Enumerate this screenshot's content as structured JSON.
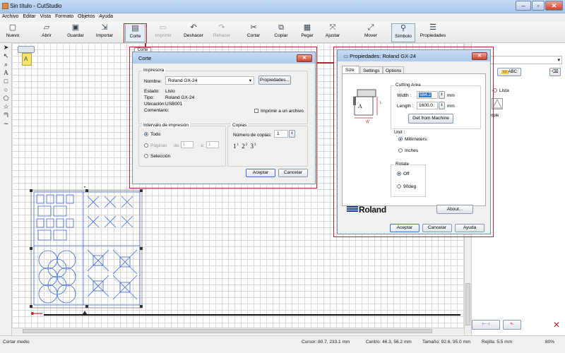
{
  "window": {
    "title": "Sin título - CutStudio"
  },
  "menu": [
    "Archivo",
    "Editar",
    "Vista",
    "Formato",
    "Objetos",
    "Ayuda"
  ],
  "toolbar": [
    {
      "label": "Nuevo",
      "icon": "new-file-icon",
      "glyph": "▢"
    },
    {
      "label": "Abrir",
      "icon": "folder-open-icon",
      "glyph": "▱"
    },
    {
      "label": "Guardar",
      "icon": "save-icon",
      "glyph": "▣"
    },
    {
      "label": "Importar",
      "icon": "import-icon",
      "glyph": "⇲"
    },
    {
      "label": "Corte",
      "icon": "cut-plotter-icon",
      "glyph": "▤"
    },
    {
      "label": "Imprimir",
      "icon": "print-icon",
      "glyph": "▭"
    },
    {
      "label": "Deshacer",
      "icon": "undo-icon",
      "glyph": "↶"
    },
    {
      "label": "Rehacer",
      "icon": "redo-icon",
      "glyph": "↷"
    },
    {
      "label": "Cortar",
      "icon": "scissors-icon",
      "glyph": "✂"
    },
    {
      "label": "Copiar",
      "icon": "copy-icon",
      "glyph": "⧉"
    },
    {
      "label": "Pegar",
      "icon": "paste-icon",
      "glyph": "▦"
    },
    {
      "label": "Ajustar",
      "icon": "fit-icon",
      "glyph": "⤧"
    },
    {
      "label": "Mover",
      "icon": "move-icon",
      "glyph": "⤢"
    },
    {
      "label": "Símbolo",
      "icon": "symbol-icon",
      "glyph": "⚲"
    },
    {
      "label": "Propiedades",
      "icon": "properties-icon",
      "glyph": "☰"
    }
  ],
  "canvas_tab": "Corte",
  "print_dialog": {
    "title": "Corte",
    "printer_group": "Impresora",
    "name_label": "Nombre:",
    "name_value": "Roland GX-24",
    "properties_btn": "Propiedades...",
    "status_label": "Estado:",
    "status_value": "Listo",
    "type_label": "Tipo:",
    "type_value": "Roland GX-24",
    "location_label": "Ubicación:",
    "location_value": "USB001",
    "comment_label": "Comentario:",
    "print_to_file": "Imprimir a un archivo",
    "range_group": "Intervalo de impresión",
    "range_all": "Todo",
    "range_pages": "Páginas",
    "from_label": "de:",
    "from_value": "1",
    "to_label": "a:",
    "to_value": "1",
    "range_selection": "Selección",
    "copies_group": "Copias",
    "copies_label": "Número de copias:",
    "copies_value": "1",
    "ok": "Aceptar",
    "cancel": "Cancelar"
  },
  "props_dialog": {
    "title": "Propiedades: Roland GX-24",
    "tabs": [
      "Size",
      "Settings",
      "Options"
    ],
    "cutting_area": "Cutting Area",
    "width_label": "Width :",
    "width_value": "584.2",
    "length_label": "Length :",
    "length_value": "1600.0",
    "mm": "mm",
    "get_from_machine": "Get from Machine",
    "unit_label": "Unit :",
    "unit_mm": "Millimeters",
    "unit_in": "Inches",
    "rotate_group": "Rotate",
    "rotate_off": "Off",
    "rotate_90": "90deg",
    "brand": "Roland",
    "about": "About...",
    "ok": "Aceptar",
    "cancel": "Cancelar",
    "help": "Ayuda",
    "diagram_a": "A",
    "diagram_w": "W",
    "diagram_l": "L"
  },
  "right_panel": {
    "abc": "ABC",
    "list_label": "Lista",
    "sample_label": "nple"
  },
  "status": {
    "hint": "Cortar medio",
    "cursor": "Cursor: 80.7, 233.1 mm",
    "center": "Centro: 46.3, 56.2 mm",
    "size": "Tamaño: 92.6, 95.0 mm",
    "grid": "Rejilla: 5.5 mm",
    "zoom": "80%"
  },
  "colors": {
    "accent": "#a52a32",
    "shape": "#3a6ad4"
  }
}
